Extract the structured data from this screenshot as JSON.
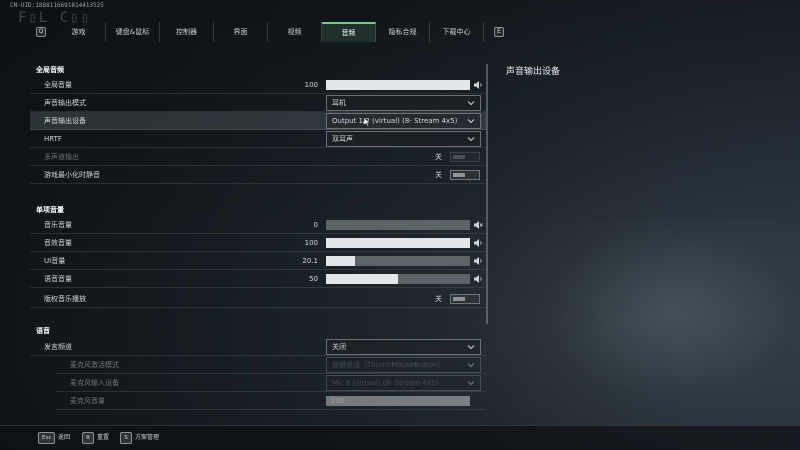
{
  "overlay": {
    "uid": "CN-UID:1888116691814413525",
    "logo": "F▯L C▯▯"
  },
  "tabs": {
    "left_key": "Q",
    "right_key": "E",
    "items": [
      {
        "label": "游戏"
      },
      {
        "label": "键盘&鼠标"
      },
      {
        "label": "控制器"
      },
      {
        "label": "界面"
      },
      {
        "label": "视频"
      },
      {
        "label": "音频",
        "active": true
      },
      {
        "label": "隐私合规"
      },
      {
        "label": "下载中心"
      }
    ]
  },
  "sections": {
    "global": {
      "title": "全局音频",
      "master_volume": {
        "label": "全局音量",
        "value": "100",
        "fill": 1.0
      },
      "output_mode": {
        "label": "声音输出模式",
        "value": "耳机"
      },
      "output_device": {
        "label": "声音输出设备",
        "value": "Output 1/2 (virtual) (8- Stream 4x5)"
      },
      "hrtf": {
        "label": "HRTF",
        "value": "双耳声"
      },
      "multichannel": {
        "label": "多声道输出",
        "state": "关"
      },
      "mute_minimized": {
        "label": "游戏最小化时静音",
        "state": "关"
      }
    },
    "individual": {
      "title": "单项音量",
      "music": {
        "label": "音乐音量",
        "value": "0",
        "fill": 0.0
      },
      "effects": {
        "label": "音效音量",
        "value": "100",
        "fill": 1.0
      },
      "ui": {
        "label": "UI音量",
        "value": "20.1",
        "fill": 0.201
      },
      "voice": {
        "label": "语音音量",
        "value": "50",
        "fill": 0.5
      },
      "copyright": {
        "label": "版权音乐播放",
        "state": "关"
      }
    },
    "voice": {
      "title": "语音",
      "channel": {
        "label": "发言频道",
        "value": "关闭"
      },
      "activation": {
        "label": "麦克风激活模式",
        "value": "按键说话（ThumbMouseButton）"
      },
      "input_device": {
        "label": "麦克风输入设备",
        "value": "Mic 8 (virtual) (8- Stream 4x5)"
      },
      "mic_volume": {
        "label": "麦克风音量",
        "value": "100",
        "fill": 1.0
      }
    }
  },
  "detail": {
    "title": "声音输出设备"
  },
  "footer": {
    "buttons": [
      {
        "key": "Esc",
        "label": "返回"
      },
      {
        "key": "R",
        "label": "重置"
      },
      {
        "key": "S",
        "label": "方案管理"
      }
    ]
  },
  "colors": {
    "accent": "#6fd08a",
    "slider_fill": "#e3e6e8",
    "slider_track": "#5d6468"
  }
}
